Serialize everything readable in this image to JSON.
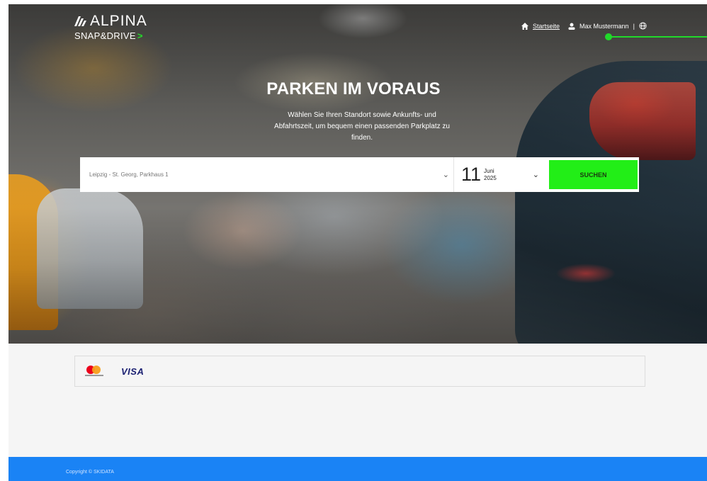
{
  "brand": {
    "name": "ALPINA",
    "tagline": "SNAP&DRIVE",
    "tagline_arrow": ">"
  },
  "nav": {
    "home_label": "Startseite",
    "user_name": "Max Mustermann",
    "separator": "|"
  },
  "hero": {
    "title": "PARKEN IM VORAUS",
    "subtitle": "Wählen Sie Ihren Standort sowie Ankunfts- und Abfahrtszeit, um bequem einen passenden Parkplatz zu finden."
  },
  "search": {
    "location_value": "Leipzig - St. Georg, Parkhaus 1",
    "date_day": "11",
    "date_month": "Juni",
    "date_year": "2025",
    "button_label": "SUCHEN"
  },
  "payments": {
    "visa_label": "VISA",
    "methods": [
      "mastercard-icon",
      "visa-logo"
    ]
  },
  "footer": {
    "copyright": "Copyright © SKIDATA"
  },
  "colors": {
    "accent_green": "#22ee17",
    "footer_blue": "#1a83f5"
  }
}
